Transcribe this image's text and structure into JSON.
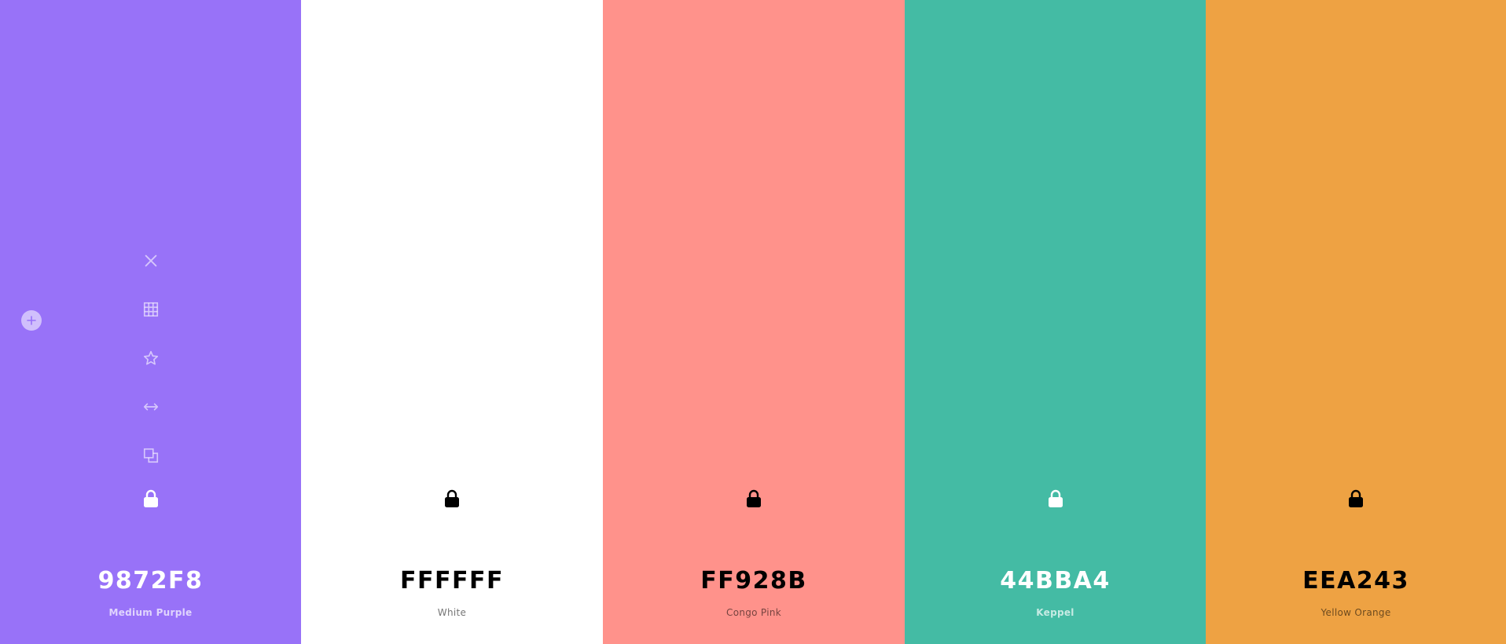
{
  "colors": {
    "purple": "#9872F8",
    "white": "#FFFFFF",
    "pink": "#FF928B",
    "keppel": "#44BBA4",
    "orange": "#EEA243",
    "light_text": "#FFFFFF",
    "dark_text": "#000000"
  },
  "swatches": [
    {
      "hex": "9872F8",
      "name": "Medium Purple",
      "lock_icon": "lock-icon"
    },
    {
      "hex": "FFFFFF",
      "name": "White",
      "lock_icon": "lock-icon"
    },
    {
      "hex": "FF928B",
      "name": "Congo Pink",
      "lock_icon": "lock-icon"
    },
    {
      "hex": "44BBA4",
      "name": "Keppel",
      "lock_icon": "lock-icon"
    },
    {
      "hex": "EEA243",
      "name": "Yellow Orange",
      "lock_icon": "lock-icon"
    }
  ],
  "toolbar_icons": [
    "close-icon",
    "grid-icon",
    "star-icon",
    "arrows-horizontal-icon",
    "copy-icon"
  ],
  "add_button_icon": "plus-icon"
}
